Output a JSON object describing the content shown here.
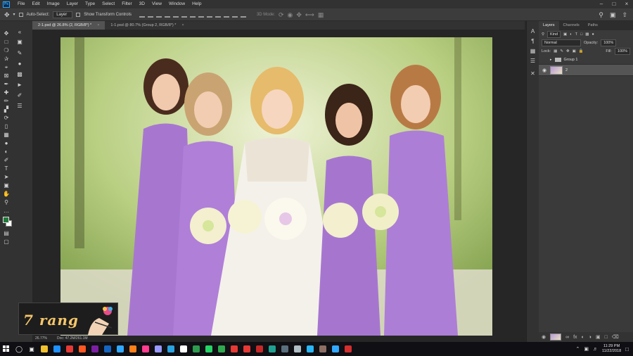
{
  "menu": [
    "File",
    "Edit",
    "Image",
    "Layer",
    "Type",
    "Select",
    "Filter",
    "3D",
    "View",
    "Window",
    "Help"
  ],
  "options": {
    "auto_select_label": "Auto-Select:",
    "auto_select_value": "Layer",
    "transform_label": "Show Transform Controls",
    "mode_3d_label": "3D Mode:"
  },
  "tabs": [
    {
      "label": "2-1.psd @ 26.8% (2, RGB/8*) *",
      "active": true
    },
    {
      "label": "1-1.psd @ 80.7% (Group 2, RGB/8*) *",
      "active": false
    }
  ],
  "status": {
    "zoom": "26.77%",
    "doc": "Doc: 47.2M/261.1M"
  },
  "watermark_text": "7 rang",
  "layers_panel": {
    "tabs": [
      "Layers",
      "Channels",
      "Paths"
    ],
    "kind_label": "Kind",
    "blend_mode": "Normal",
    "opacity_label": "Opacity:",
    "opacity_value": "100%",
    "lock_label": "Lock:",
    "fill_label": "Fill:",
    "fill_value": "100%",
    "layers": [
      {
        "name": "Group 1",
        "type": "group"
      },
      {
        "name": "2",
        "type": "image",
        "selected": true
      }
    ]
  },
  "taskbar": {
    "time": "11:29 PM",
    "date": "11/22/2018",
    "app_colors": [
      "#f2c12e",
      "#1e90ff",
      "#e53935",
      "#ff5722",
      "#7b1fa2",
      "#1565c0",
      "#31a8ff",
      "#ff7f18",
      "#ff3c8e",
      "#9999ff",
      "#2aa3e0",
      "#ffffff",
      "#2e9b4f",
      "#25d366",
      "#2fa84f",
      "#e53935",
      "#e53935",
      "#c62828",
      "#20a090",
      "#5a6e7d",
      "#b0bec5",
      "#29b6f6",
      "#8d6e63",
      "#31a8ff",
      "#d32f2f"
    ]
  }
}
